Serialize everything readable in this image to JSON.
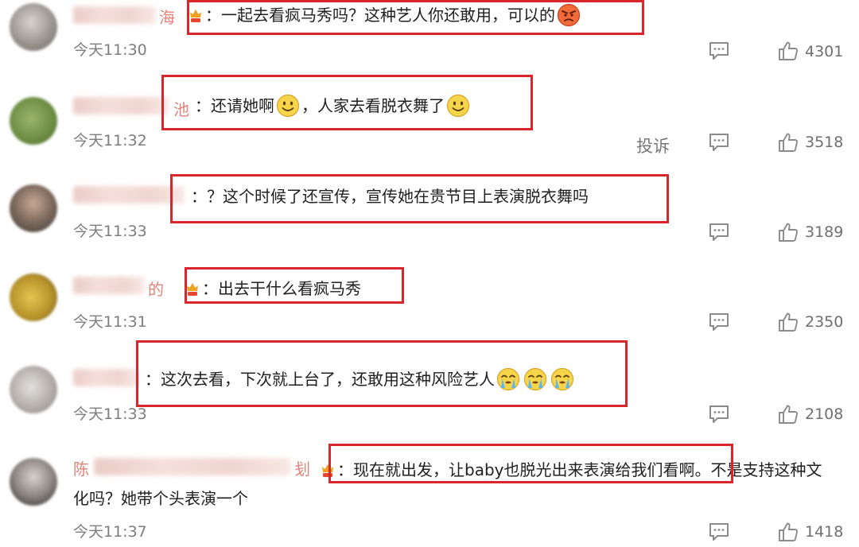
{
  "comments": [
    {
      "name_tail": "海",
      "text": "：一起去看疯马秀吗？这种艺人你还敢用，可以的",
      "time": "今天11:30",
      "likes": "4301"
    },
    {
      "name_tail": "池",
      "text_a": "：还请她啊",
      "text_b": "，人家去看脱衣舞了",
      "time": "今天11:32",
      "report": "投诉",
      "likes": "3518"
    },
    {
      "name_tail": "",
      "text": "：？这个时候了还宣传，宣传她在贵节目上表演脱衣舞吗",
      "time": "今天11:33",
      "likes": "3189"
    },
    {
      "name_tail": "的",
      "text": "：出去干什么看疯马秀",
      "time": "今天11:31",
      "likes": "2350"
    },
    {
      "name_tail": "",
      "text": "：这次去看，下次就上台了，还敢用这种风险艺人",
      "time": "今天11:33",
      "likes": "2108"
    },
    {
      "name_head": "陈",
      "name_tail": "刬",
      "text_line1": "：现在就出发，让baby也脱光出来表演给我们看啊。不是支持这种文",
      "text_line2": "化吗？她带个头表演一个",
      "time": "今天11:37",
      "likes": "1418"
    }
  ],
  "colors": {
    "highlight": "#d9262d",
    "username": "#e2827a",
    "meta": "#7d7d7d"
  },
  "icons": [
    "comment-icon",
    "thumbs-up-icon",
    "smile-emoji",
    "angry-emoji",
    "crying-emoji",
    "vip-crown-icon"
  ]
}
